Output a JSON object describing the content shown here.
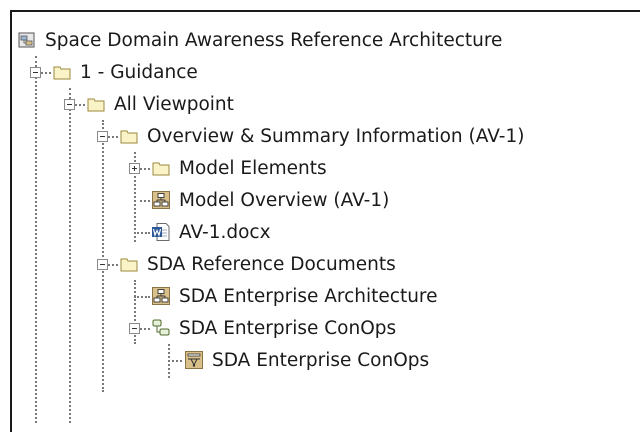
{
  "tree": {
    "root": {
      "label": "Space Domain Awareness Reference Architecture",
      "icon": "model-package-icon"
    },
    "nodes": [
      {
        "label": "1 - Guidance",
        "icon": "folder-icon",
        "state": "expanded"
      },
      {
        "label": "All Viewpoint",
        "icon": "folder-icon",
        "state": "expanded"
      },
      {
        "label": "Overview & Summary Information (AV-1)",
        "icon": "folder-icon",
        "state": "expanded"
      },
      {
        "label": "Model Elements",
        "icon": "folder-icon",
        "state": "collapsed"
      },
      {
        "label": "Model Overview (AV-1)",
        "icon": "diagram-icon",
        "state": "leaf"
      },
      {
        "label": "AV-1.docx",
        "icon": "word-document-icon",
        "state": "leaf"
      },
      {
        "label": "SDA Reference Documents",
        "icon": "folder-icon",
        "state": "expanded"
      },
      {
        "label": "SDA Enterprise Architecture",
        "icon": "diagram-icon",
        "state": "leaf"
      },
      {
        "label": "SDA Enterprise ConOps",
        "icon": "conops-element-icon",
        "state": "expanded"
      },
      {
        "label": "SDA Enterprise ConOps",
        "icon": "conops-diagram-icon",
        "state": "leaf"
      }
    ]
  },
  "colors": {
    "folder_fill": "#fbf3c8",
    "folder_stroke": "#9b8a3c",
    "diagram_bg": "#d9c08a",
    "word_blue": "#2b5797",
    "selection_outline": "#1a1a1a"
  }
}
